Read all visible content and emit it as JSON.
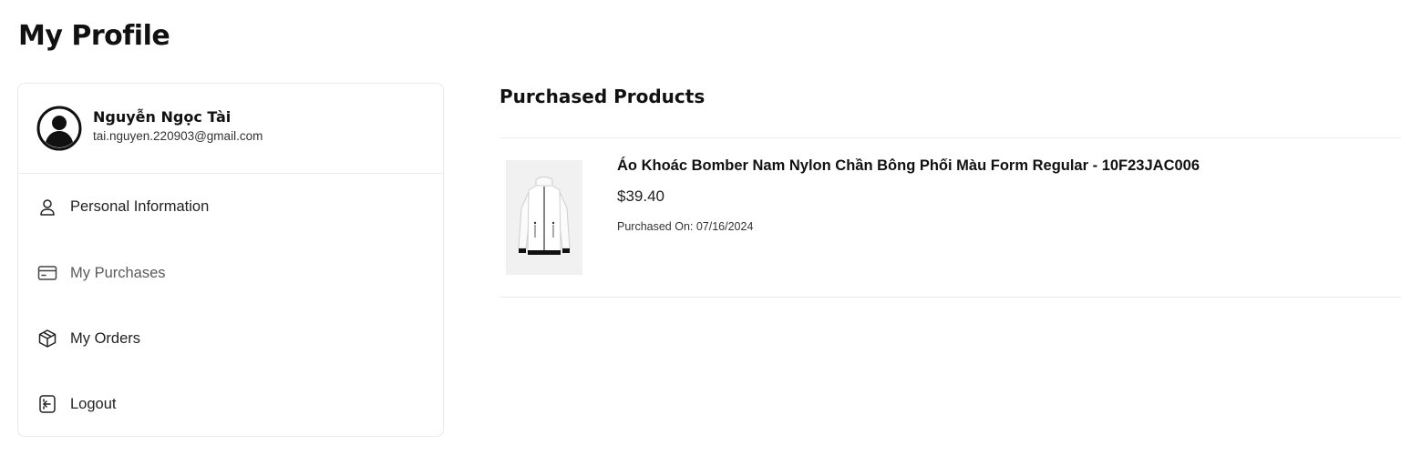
{
  "page": {
    "title": "My Profile"
  },
  "user": {
    "name": "Nguyễn Ngọc Tài",
    "email": "tai.nguyen.220903@gmail.com",
    "avatar_icon": "user-circle-icon"
  },
  "sidebar": {
    "items": [
      {
        "label": "Personal Information",
        "icon": "user-icon",
        "active": false
      },
      {
        "label": "My Purchases",
        "icon": "credit-card-icon",
        "active": true
      },
      {
        "label": "My Orders",
        "icon": "package-icon",
        "active": false
      },
      {
        "label": "Logout",
        "icon": "logout-icon",
        "active": false
      }
    ]
  },
  "purchases": {
    "title": "Purchased Products",
    "items": [
      {
        "name": "Áo Khoác Bomber Nam Nylon Chần Bông Phối Màu Form Regular - 10F23JAC006",
        "price": "$39.40",
        "purchased_on": "Purchased On: 07/16/2024",
        "image": "white-bomber-jacket"
      }
    ]
  }
}
